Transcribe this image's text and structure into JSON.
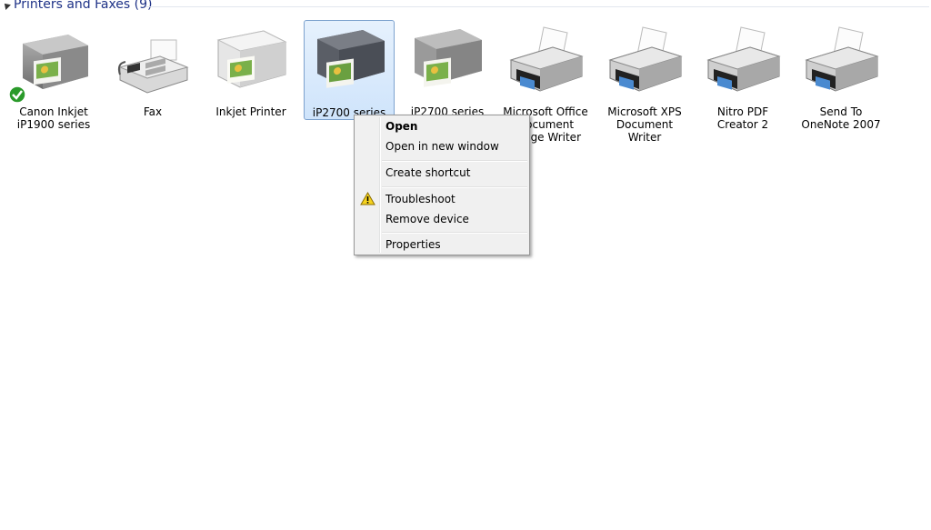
{
  "group": {
    "title": "Printers and Faxes (9)"
  },
  "devices": [
    {
      "label": "Canon Inkjet iP1900 series",
      "icon": "printer-icon",
      "default": true
    },
    {
      "label": "Fax",
      "icon": "fax-icon"
    },
    {
      "label": "Inkjet Printer",
      "icon": "printer-icon"
    },
    {
      "label": "iP2700 series",
      "icon": "printer-icon",
      "selected": true
    },
    {
      "label": "iP2700 series",
      "icon": "printer-icon"
    },
    {
      "label": "Microsoft Office Document Image Writer",
      "icon": "printer-icon"
    },
    {
      "label": "Microsoft XPS Document Writer",
      "icon": "printer-icon"
    },
    {
      "label": "Nitro PDF Creator 2",
      "icon": "printer-icon"
    },
    {
      "label": "Send To OneNote 2007",
      "icon": "printer-icon"
    }
  ],
  "context_menu": {
    "open": "Open",
    "open_new_window": "Open in new window",
    "create_shortcut": "Create shortcut",
    "troubleshoot": "Troubleshoot",
    "remove_device": "Remove device",
    "properties": "Properties"
  },
  "colors": {
    "header_text": "#1e3287",
    "selection_border": "#7da2ce",
    "menu_bg": "#f0f0f0"
  }
}
